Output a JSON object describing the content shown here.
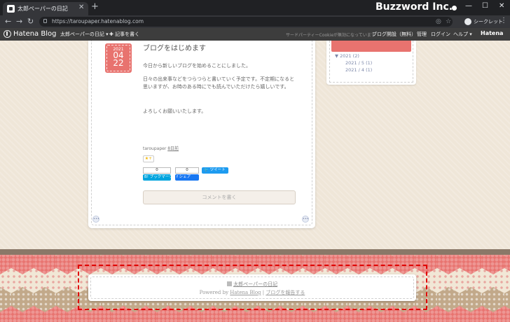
{
  "browser": {
    "tab_title": "太郎ペーパーの日記",
    "tab_close": "✕",
    "new_tab": "+",
    "url": "https://taroupaper.hatenablog.com",
    "incognito_label": "シークレット",
    "overlay_brand": "Buzzword Inc.",
    "window_buttons": [
      "—",
      "☐",
      "✕"
    ],
    "nav_icons": [
      "back-icon",
      "forward-icon",
      "reload-icon"
    ]
  },
  "hatena_bar": {
    "logo_text": "Hatena Blog",
    "blog_menu": "太郎ペーパーの日記 ▾",
    "write_button": "✚ 記事を書く",
    "notice": "サードパーティーCookieが無効になっています",
    "links": [
      "ブログ開設（無料）",
      "管理",
      "ログイン",
      "ヘルプ ▾"
    ],
    "right_logo": "Hatena"
  },
  "entry": {
    "date": {
      "year": "2021",
      "month": "04",
      "day": "22"
    },
    "title": "ブログをはじめます",
    "paragraphs": [
      "今日から新しいブログを始めることにしました。",
      "日々の出来事などをつらつらと書いていく予定です。不定期になると思いますが、お時のある時にでも読んでいただけたら嬉しいです。",
      "よろしくお願いいたします。"
    ],
    "author": "taroupaper",
    "time_ago": "8日前",
    "star": "★+",
    "hatena_bookmark": {
      "count": "0",
      "label": "B! ブックマーク"
    },
    "facebook_share": {
      "count": "0",
      "label": "f シェア"
    },
    "tweet": "🐦 ツイート",
    "comment_button": "コメントを書く"
  },
  "archive": {
    "year_item": "▼ 2021 (2)",
    "months": [
      "2021 / 5 (1)",
      "2021 / 4 (1)"
    ]
  },
  "footer": {
    "blog_name": "太郎ペーパーの日記",
    "powered_prefix": "Powered by ",
    "powered_link": "Hatena Blog",
    "separator": " | ",
    "report_link": "ブログを報告する"
  },
  "colors": {
    "accent_red": "#e8736f",
    "link_blue": "#7a86a8",
    "highlight_border": "#e00000"
  }
}
